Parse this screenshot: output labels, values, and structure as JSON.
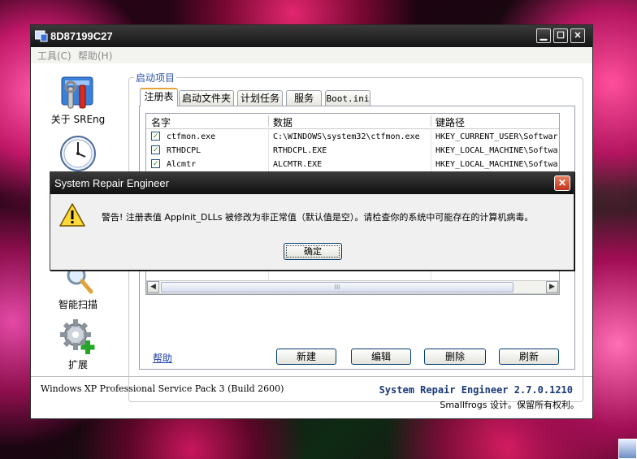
{
  "window": {
    "title": "8D87199C27"
  },
  "menu": {
    "tools": "工具(C)",
    "help": "帮助(H)"
  },
  "nav": [
    {
      "label": "关于 SREng",
      "icon": "tools-icon"
    },
    {
      "label": "",
      "icon": "clock-icon"
    },
    {
      "label": "智能扫描",
      "icon": "magnifier-icon"
    },
    {
      "label": "扩展",
      "icon": "gear-plus-icon"
    }
  ],
  "group": {
    "label": "启动项目"
  },
  "tabs": [
    "注册表",
    "启动文件夹",
    "计划任务",
    "服务",
    "Boot.ini"
  ],
  "table": {
    "columns": [
      "名字",
      "数据",
      "键路径"
    ],
    "rows": [
      {
        "name": "ctfmon.exe",
        "data": "C:\\WINDOWS\\system32\\ctfmon.exe",
        "path": "HKEY_CURRENT_USER\\Softwar"
      },
      {
        "name": "RTHDCPL",
        "data": "RTHDCPL.EXE",
        "path": "HKEY_LOCAL_MACHINE\\Softwa"
      },
      {
        "name": "Alcmtr",
        "data": "ALCMTR.EXE",
        "path": "HKEY_LOCAL_MACHINE\\Softwa"
      }
    ]
  },
  "scrollbar": {
    "grip": "III"
  },
  "buttons": {
    "help": "帮助",
    "new": "新建",
    "edit": "编辑",
    "delete": "删除",
    "refresh": "刷新"
  },
  "status": {
    "os": "Windows XP Professional Service Pack 3 (Build 2600)",
    "product": "System Repair Engineer 2.7.0.1210",
    "copyright": "Smallfrogs 设计。保留所有权利。"
  },
  "dialog": {
    "title": "System Repair Engineer",
    "message": "警告! 注册表值 AppInit_DLLs 被修改为非正常值（默认值是空）。请检查你的系统中可能存在的计算机病毒。",
    "ok": "确定"
  }
}
